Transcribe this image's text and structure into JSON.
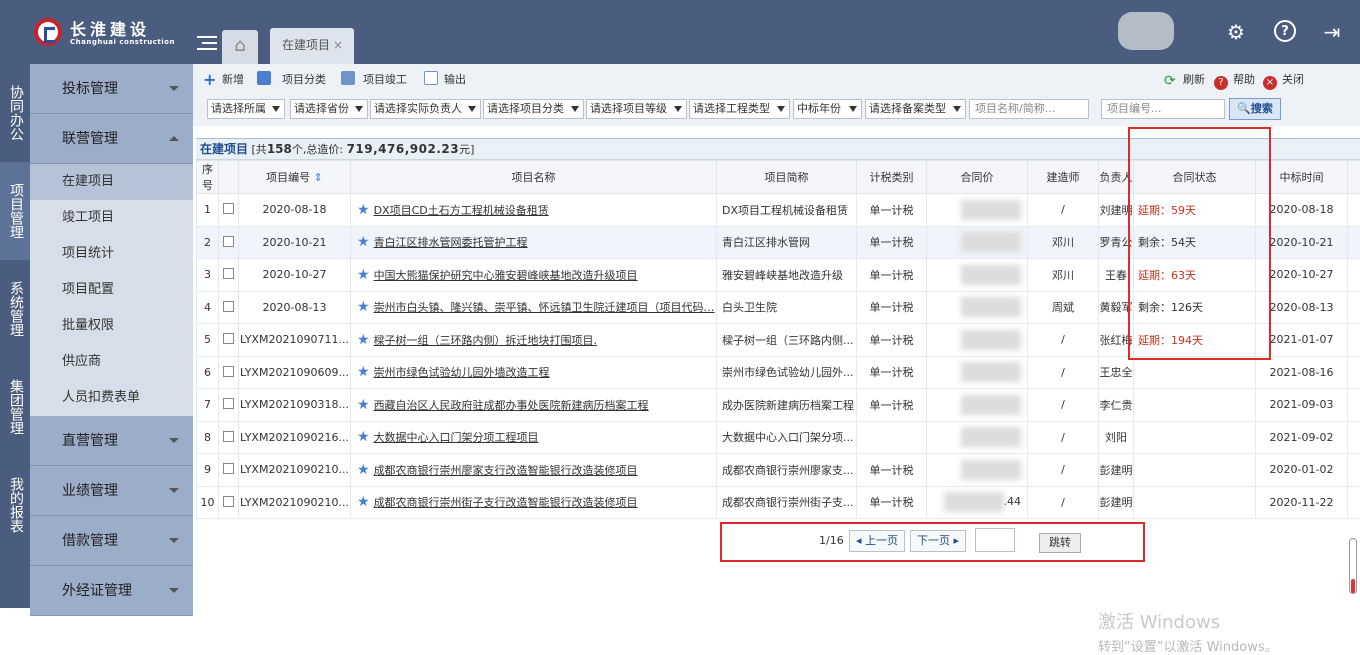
{
  "header": {
    "logo_cn": "长淮建设",
    "logo_en": "Changhuai construction",
    "home_tab_icon": "home-icon",
    "current_tab": "在建项目",
    "tab_close": "×"
  },
  "vnav": [
    "协同办公",
    "项目管理",
    "系统管理",
    "集团管理",
    "我的报表"
  ],
  "sidebar": {
    "groups": [
      {
        "label": "投标管理"
      },
      {
        "label": "联营管理"
      },
      {
        "label": "直营管理"
      },
      {
        "label": "业绩管理"
      },
      {
        "label": "借款管理"
      },
      {
        "label": "外经证管理"
      }
    ],
    "sub_items": [
      "在建项目",
      "竣工项目",
      "项目统计",
      "项目配置",
      "批量权限",
      "供应商",
      "人员扣费表单"
    ]
  },
  "toolbar": {
    "add": "新增",
    "category": "项目分类",
    "complete": "项目竣工",
    "export": "输出",
    "refresh": "刷新",
    "help": "帮助",
    "close": "关闭"
  },
  "filters": {
    "selects": [
      "请选择所属",
      "请选择省份",
      "请选择实际负责人",
      "请选择项目分类",
      "请选择项目等级",
      "请选择工程类型",
      "中标年份",
      "请选择备案类型"
    ],
    "name_placeholder": "项目名称/简称...",
    "code_placeholder": "项目编号...",
    "search_label": "搜索"
  },
  "grid": {
    "title": "在建项目",
    "summary_pre": "[共",
    "count": "158",
    "summary_mid": "个,总造价:",
    "total": "719,476,902.23",
    "summary_post": "元]",
    "columns": [
      "序号",
      "项目编号",
      "项目名称",
      "项目简称",
      "计税类别",
      "合同价",
      "建造师",
      "负责人",
      "合同状态",
      "中标时间"
    ],
    "rows": [
      {
        "no": "1",
        "code": "2020-08-18",
        "name": "DX项目CD土石方工程机械设备租赁",
        "abbr": "DX项目工程机械设备租赁",
        "tax": "单一计税",
        "price_tail": "",
        "builder": "/",
        "owner": "刘建明",
        "status": "延期：59天",
        "status_type": "delay",
        "date": "2020-08-18"
      },
      {
        "no": "2",
        "code": "2020-10-21",
        "name": "青白江区排水管网委托管护工程",
        "abbr": "青白江区排水管网",
        "tax": "单一计税",
        "price_tail": "",
        "builder": "邓川",
        "owner": "罗青公",
        "status": "剩余：54天",
        "status_type": "remain",
        "date": "2020-10-21"
      },
      {
        "no": "3",
        "code": "2020-10-27",
        "name": "中国大熊猫保护研究中心雅安碧峰峡基地改造升级项目",
        "abbr": "雅安碧峰峡基地改造升级",
        "tax": "单一计税",
        "price_tail": "",
        "builder": "邓川",
        "owner": "王春",
        "status": "延期：63天",
        "status_type": "delay",
        "date": "2020-10-27"
      },
      {
        "no": "4",
        "code": "2020-08-13",
        "name": "崇州市白头镇、隆兴镇、崇平镇、怀远镇卫生院迁建项目（项目代码…",
        "abbr": "白头卫生院",
        "tax": "单一计税",
        "price_tail": "",
        "builder": "周斌",
        "owner": "黄毅军",
        "status": "剩余：126天",
        "status_type": "remain",
        "date": "2020-08-13"
      },
      {
        "no": "5",
        "code": "LYXM2021090711...",
        "name": "樑子树一组（三环路内侧）拆迁地块打围项目.",
        "abbr": "樑子树一组（三环路内侧...",
        "tax": "单一计税",
        "price_tail": "",
        "builder": "/",
        "owner": "张红梅",
        "status": "延期：194天",
        "status_type": "delay",
        "date": "2021-01-07"
      },
      {
        "no": "6",
        "code": "LYXM2021090609...",
        "name": "崇州市绿色试验幼儿园外墙改造工程",
        "abbr": "崇州市绿色试验幼儿园外...",
        "tax": "单一计税",
        "price_tail": "",
        "builder": "/",
        "owner": "王忠全",
        "status": "",
        "status_type": "",
        "date": "2021-08-16"
      },
      {
        "no": "7",
        "code": "LYXM2021090318...",
        "name": "西藏自治区人民政府驻成都办事处医院新建病历档案工程",
        "abbr": "成办医院新建病历档案工程",
        "tax": "单一计税",
        "price_tail": "",
        "builder": "/",
        "owner": "李仁贵",
        "status": "",
        "status_type": "",
        "date": "2021-09-03"
      },
      {
        "no": "8",
        "code": "LYXM2021090216...",
        "name": "大数据中心入口门架分项工程项目",
        "abbr": "大数据中心入口门架分项...",
        "tax": "",
        "price_tail": "",
        "builder": "/",
        "owner": "刘阳",
        "status": "",
        "status_type": "",
        "date": "2021-09-02"
      },
      {
        "no": "9",
        "code": "LYXM2021090210...",
        "name": "成都农商银行崇州廖家支行改造智能银行改造装修项目",
        "abbr": "成都农商银行崇州廖家支...",
        "tax": "单一计税",
        "price_tail": "",
        "builder": "/",
        "owner": "彭建明",
        "status": "",
        "status_type": "",
        "date": "2020-01-02"
      },
      {
        "no": "10",
        "code": "LYXM2021090210...",
        "name": "成都农商银行崇州街子支行改造智能银行改造装修项目",
        "abbr": "成都农商银行崇州街子支...",
        "tax": "单一计税",
        "price_tail": ".44",
        "builder": "/",
        "owner": "彭建明",
        "status": "",
        "status_type": "",
        "date": "2020-11-22"
      }
    ]
  },
  "pager": {
    "info": "1/16",
    "prev": "◂ 上一页",
    "next": "下一页 ▸",
    "jump": "跳转"
  },
  "watermark": {
    "line1": "激活 Windows",
    "line2": "转到“设置”以激活 Windows。"
  },
  "colors": {
    "header_bg": "#4a5d7e",
    "sidebar_bg": "#9badc8",
    "delay_red": "#c8321e",
    "highlight_box": "#e02a2a"
  }
}
